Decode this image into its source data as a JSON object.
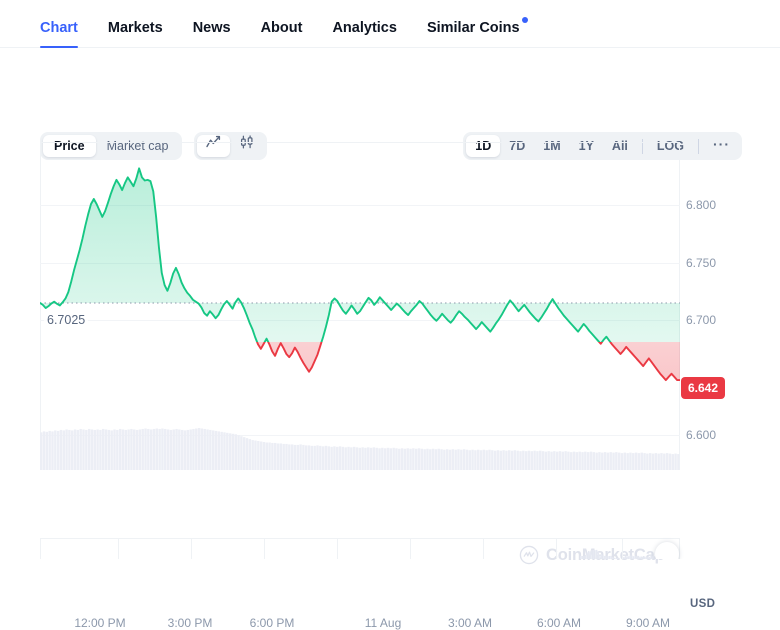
{
  "tabs": [
    {
      "label": "Chart",
      "active": true,
      "badge": false
    },
    {
      "label": "Markets",
      "active": false,
      "badge": false
    },
    {
      "label": "News",
      "active": false,
      "badge": false
    },
    {
      "label": "About",
      "active": false,
      "badge": false
    },
    {
      "label": "Analytics",
      "active": false,
      "badge": false
    },
    {
      "label": "Similar Coins",
      "active": false,
      "badge": true
    }
  ],
  "toolbar": {
    "metric": {
      "options": [
        {
          "label": "Price",
          "active": true
        },
        {
          "label": "Market cap",
          "active": false
        }
      ]
    },
    "style": {
      "options": [
        {
          "icon": "line-chart-icon",
          "active": true
        },
        {
          "icon": "candlestick-icon",
          "active": false
        }
      ]
    },
    "range": {
      "options": [
        {
          "label": "1D",
          "active": true
        },
        {
          "label": "7D",
          "active": false
        },
        {
          "label": "1M",
          "active": false
        },
        {
          "label": "1Y",
          "active": false
        },
        {
          "label": "All",
          "active": false
        }
      ],
      "log_label": "LOG",
      "more_label": "···"
    }
  },
  "watermark": {
    "text": "CoinMarketCap",
    "logo": "coinmarketcap-logo-icon"
  },
  "colors": {
    "accent": "#3861fb",
    "up": "#16c784",
    "down": "#ea3943",
    "axis_text": "#8c98ab",
    "grid": "#f2f4f7"
  },
  "chart_data": {
    "type": "area",
    "title": "",
    "xlabel": "",
    "ylabel": "USD",
    "currency": "USD",
    "grid": true,
    "legend": "none",
    "ylim": [
      6.5715,
      6.8287
    ],
    "y_ticks": [
      "6.800",
      "6.750",
      "6.700",
      "6.600"
    ],
    "y_tick_values": [
      6.8,
      6.75,
      6.7,
      6.6
    ],
    "x_ticks": [
      "12:00 PM",
      "3:00 PM",
      "6:00 PM",
      "11 Aug",
      "3:00 AM",
      "6:00 AM",
      "9:00 AM"
    ],
    "baseline": {
      "value": 6.7025,
      "label": "6.7025"
    },
    "current_price": {
      "value": 6.642,
      "label": "6.642"
    },
    "series": [
      {
        "name": "Price",
        "up_color": "#16c784",
        "down_color": "#ea3943",
        "values": [
          6.7025,
          6.701,
          6.6985,
          6.7,
          6.702,
          6.7035,
          6.7018,
          6.7005,
          6.703,
          6.706,
          6.711,
          6.719,
          6.728,
          6.736,
          6.744,
          6.753,
          6.763,
          6.772,
          6.78,
          6.784,
          6.78,
          6.775,
          6.77,
          6.7745,
          6.781,
          6.788,
          6.794,
          6.799,
          6.7955,
          6.791,
          6.7965,
          6.801,
          6.7975,
          6.794,
          6.8,
          6.808,
          6.801,
          6.7985,
          6.799,
          6.798,
          6.79,
          6.77,
          6.746,
          6.726,
          6.7165,
          6.712,
          6.718,
          6.7255,
          6.73,
          6.725,
          6.7185,
          6.714,
          6.7105,
          6.708,
          6.705,
          6.7035,
          6.702,
          6.699,
          6.6945,
          6.6925,
          6.696,
          6.6935,
          6.6905,
          6.693,
          6.6975,
          6.7015,
          6.704,
          6.701,
          6.698,
          6.703,
          6.706,
          6.703,
          6.6985,
          6.693,
          6.687,
          6.682,
          6.6755,
          6.67,
          6.6665,
          6.6705,
          6.6745,
          6.67,
          6.6645,
          6.661,
          6.6665,
          6.671,
          6.667,
          6.6625,
          6.66,
          6.663,
          6.6675,
          6.664,
          6.6595,
          6.6555,
          6.652,
          6.6485,
          6.652,
          6.657,
          6.662,
          6.669,
          6.676,
          6.684,
          6.693,
          6.7035,
          6.706,
          6.704,
          6.7,
          6.6965,
          6.694,
          6.697,
          6.7005,
          6.6975,
          6.694,
          6.696,
          6.6995,
          6.703,
          6.7065,
          6.7045,
          6.701,
          6.7035,
          6.707,
          6.7045,
          6.702,
          6.6995,
          6.697,
          6.6995,
          6.702,
          6.7,
          6.6975,
          6.695,
          6.693,
          6.696,
          6.6985,
          6.701,
          6.704,
          6.702,
          6.699,
          6.696,
          6.693,
          6.6905,
          6.6885,
          6.691,
          6.694,
          6.6915,
          6.689,
          6.687,
          6.6895,
          6.693,
          6.696,
          6.694,
          6.6915,
          6.6895,
          6.687,
          6.6845,
          6.682,
          6.6845,
          6.6875,
          6.685,
          6.6825,
          6.68,
          6.683,
          6.6865,
          6.6895,
          6.693,
          6.697,
          6.701,
          6.7045,
          6.702,
          6.699,
          6.696,
          6.6985,
          6.701,
          6.698,
          6.695,
          6.6925,
          6.69,
          6.688,
          6.691,
          6.6945,
          6.698,
          6.702,
          6.7055,
          6.702,
          6.6985,
          6.6955,
          6.6925,
          6.69,
          6.6875,
          6.685,
          6.6825,
          6.68,
          6.683,
          6.686,
          6.6835,
          6.6805,
          6.678,
          6.6755,
          6.673,
          6.6705,
          6.6735,
          6.676,
          6.673,
          6.67,
          6.6675,
          6.665,
          6.6625,
          6.665,
          6.668,
          6.6655,
          6.663,
          6.6605,
          6.658,
          6.6555,
          6.653,
          6.656,
          6.659,
          6.656,
          6.653,
          6.65,
          6.647,
          6.6445,
          6.642,
          6.6445,
          6.647,
          6.6445,
          6.642,
          6.642
        ]
      }
    ],
    "volume": {
      "name": "Volume",
      "color": "#eceef5",
      "values": [
        78,
        80,
        79,
        81,
        80,
        82,
        81,
        83,
        82,
        84,
        83,
        82,
        84,
        83,
        85,
        84,
        83,
        85,
        84,
        83,
        84,
        83,
        85,
        84,
        83,
        82,
        84,
        83,
        85,
        84,
        83,
        84,
        85,
        84,
        83,
        84,
        85,
        86,
        85,
        84,
        85,
        86,
        85,
        86,
        85,
        84,
        83,
        84,
        85,
        84,
        83,
        82,
        83,
        84,
        85,
        86,
        87,
        86,
        85,
        84,
        83,
        82,
        81,
        80,
        79,
        78,
        77,
        76,
        75,
        74,
        72,
        70,
        68,
        66,
        64,
        62,
        61,
        60,
        59,
        58,
        57,
        57,
        56,
        56,
        55,
        55,
        54,
        54,
        53,
        53,
        52,
        52,
        53,
        52,
        51,
        51,
        50,
        50,
        51,
        50,
        49,
        50,
        49,
        48,
        49,
        48,
        49,
        48,
        47,
        48,
        47,
        48,
        47,
        46,
        47,
        46,
        47,
        46,
        47,
        46,
        45,
        46,
        45,
        46,
        45,
        46,
        45,
        44,
        45,
        44,
        45,
        44,
        45,
        44,
        45,
        44,
        43,
        44,
        43,
        44,
        43,
        44,
        43,
        42,
        43,
        42,
        43,
        42,
        43,
        42,
        43,
        42,
        41,
        42,
        41,
        42,
        41,
        42,
        41,
        42,
        41,
        40,
        41,
        40,
        41,
        40,
        41,
        40,
        41,
        40,
        39,
        40,
        39,
        40,
        39,
        40,
        39,
        40,
        39,
        38,
        39,
        38,
        39,
        38,
        39,
        38,
        39,
        38,
        37,
        38,
        37,
        38,
        37,
        38,
        37,
        38,
        37,
        36,
        37,
        36,
        37,
        36,
        37,
        36,
        37,
        36,
        35,
        36,
        35,
        36,
        35,
        36,
        35,
        36,
        35,
        34,
        35,
        34,
        35,
        34,
        35,
        34,
        35,
        34,
        33,
        34,
        33
      ]
    }
  }
}
